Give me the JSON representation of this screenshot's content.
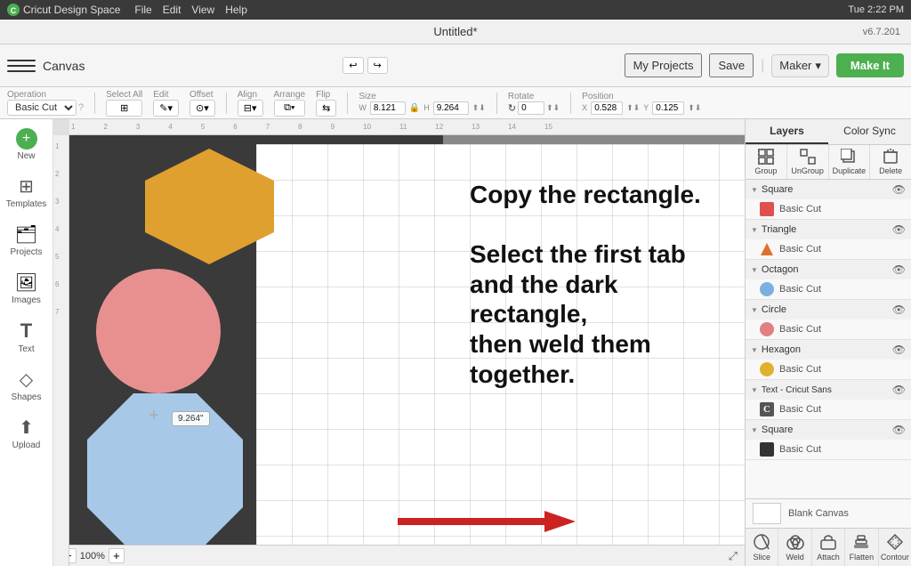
{
  "app": {
    "name": "Cricut Design Space",
    "version": "v6.7.201",
    "time": "Tue 2:22 PM",
    "title": "Untitled*"
  },
  "menubar": {
    "items": [
      "File",
      "Edit",
      "View",
      "Help"
    ]
  },
  "toolbar": {
    "canvas_label": "Canvas",
    "my_projects": "My Projects",
    "save": "Save",
    "maker": "Maker",
    "make_it": "Make It"
  },
  "operation": {
    "label": "Operation",
    "value": "Basic Cut",
    "select_all": "Select All",
    "edit": "Edit",
    "offset": "Offset",
    "align": "Align",
    "arrange": "Arrange",
    "flip": "Flip",
    "size_label": "Size",
    "w": "8.121",
    "h": "9.264",
    "rotate_label": "Rotate",
    "rotate_val": "0",
    "position_label": "Position",
    "x": "0.528",
    "y": "0.125"
  },
  "sidebar": {
    "items": [
      {
        "label": "New",
        "icon": "+"
      },
      {
        "label": "Templates",
        "icon": "⊞"
      },
      {
        "label": "Projects",
        "icon": "📁"
      },
      {
        "label": "Images",
        "icon": "🖼"
      },
      {
        "label": "Text",
        "icon": "T"
      },
      {
        "label": "Shapes",
        "icon": "◇"
      },
      {
        "label": "Upload",
        "icon": "⬆"
      }
    ]
  },
  "canvas": {
    "zoom": "100%",
    "crosshair": "+",
    "size_indicator": "9.264\""
  },
  "canvas_text": {
    "line1": "Copy the rectangle.",
    "line2": "Select the first tab",
    "line3": "and the dark rectangle,",
    "line4": "then weld them together."
  },
  "layers_panel": {
    "tabs": [
      "Layers",
      "Color Sync"
    ],
    "action_buttons": [
      "Group",
      "UnGroup",
      "Duplicate",
      "Delete"
    ],
    "groups": [
      {
        "name": "Square",
        "items": [
          {
            "label": "Basic Cut",
            "color": "#e05050",
            "shape": "square"
          }
        ]
      },
      {
        "name": "Triangle",
        "items": [
          {
            "label": "Basic Cut",
            "color": "#e07030",
            "shape": "triangle"
          }
        ]
      },
      {
        "name": "Octagon",
        "items": [
          {
            "label": "Basic Cut",
            "color": "#7bb0e0",
            "shape": "circle"
          }
        ]
      },
      {
        "name": "Circle",
        "items": [
          {
            "label": "Basic Cut",
            "color": "#e08080",
            "shape": "circle"
          }
        ]
      },
      {
        "name": "Hexagon",
        "items": [
          {
            "label": "Basic Cut",
            "color": "#e0b030",
            "shape": "circle"
          }
        ]
      },
      {
        "name": "Text - Cricut Sans",
        "items": [
          {
            "label": "Basic Cut",
            "color": "#555",
            "shape": "text"
          }
        ]
      },
      {
        "name": "Square",
        "items": [
          {
            "label": "Basic Cut",
            "color": "#333",
            "shape": "square"
          }
        ]
      }
    ],
    "blank_canvas": "Blank Canvas",
    "bottom_actions": [
      "Slice",
      "Weld",
      "Attach",
      "Flatten",
      "Contour"
    ]
  }
}
